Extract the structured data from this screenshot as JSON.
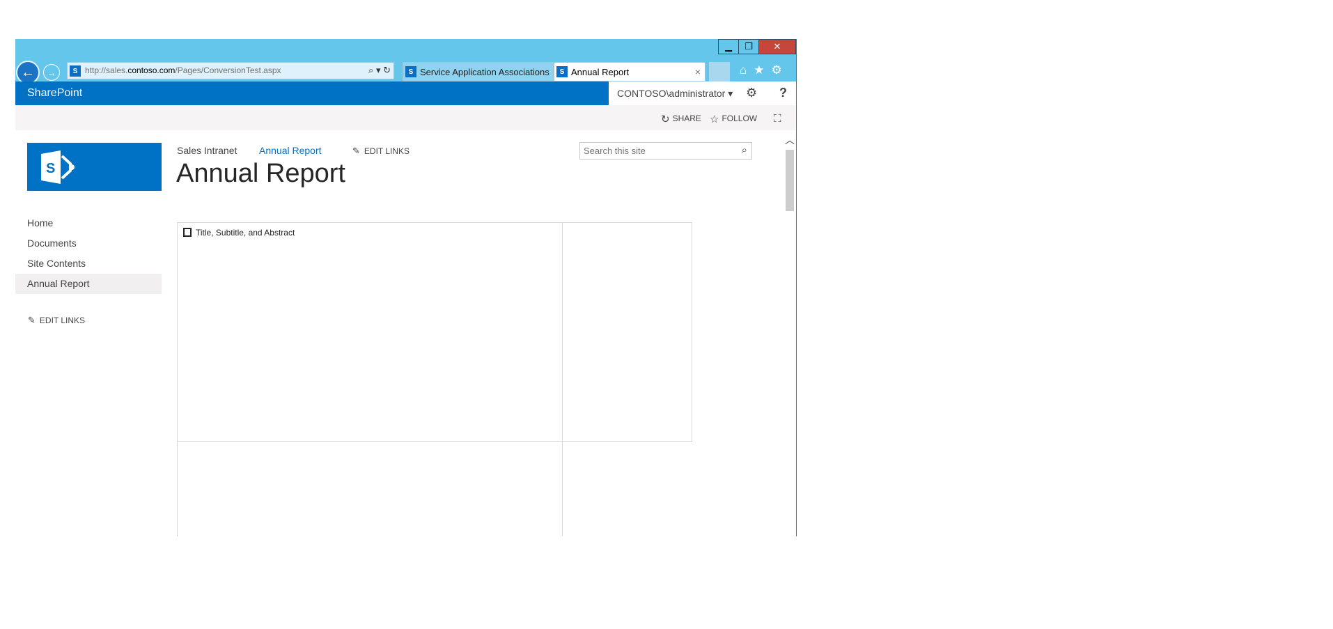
{
  "browser": {
    "address": {
      "url_prefix": "http://sales.",
      "url_domain": "contoso.com",
      "url_path": "/Pages/ConversionTest.aspx",
      "search_glyph": "⌕ ▾",
      "refresh_glyph": "↻"
    },
    "tabs": [
      {
        "label": "Service Application Associations"
      },
      {
        "label": "Annual Report",
        "close": "×"
      }
    ],
    "window_controls": {
      "minimize": "▁",
      "maximize": "❐",
      "close": "✕"
    }
  },
  "suite": {
    "brand": "SharePoint",
    "user": "CONTOSO\\administrator",
    "user_caret": "▾"
  },
  "actions": {
    "share": "SHARE",
    "follow": "FOLLOW"
  },
  "topnav": {
    "items": [
      "Sales Intranet",
      "Annual Report"
    ],
    "edit_links": "EDIT LINKS"
  },
  "page": {
    "title": "Annual Report"
  },
  "search": {
    "placeholder": "Search this site"
  },
  "leftnav": {
    "items": [
      "Home",
      "Documents",
      "Site Contents",
      "Annual Report"
    ],
    "selected": "Annual Report",
    "edit_links": "EDIT LINKS"
  },
  "zones": {
    "first_label": "Title, Subtitle, and Abstract"
  },
  "colors": {
    "suite_blue": "#0072c6",
    "browser_chrome": "#65c6ec",
    "close_red": "#c7463c"
  }
}
